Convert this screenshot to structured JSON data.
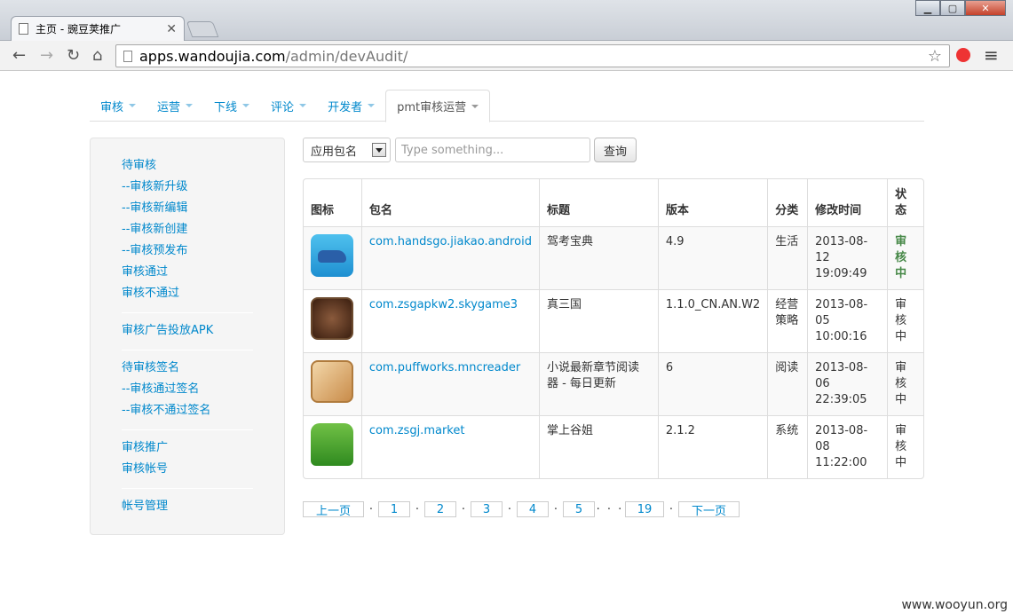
{
  "browser": {
    "tab_title": "主页 - 豌豆荚推广",
    "url_host": "apps.wandoujia.com",
    "url_path": "/admin/devAudit/"
  },
  "topnav": [
    {
      "label": "审核"
    },
    {
      "label": "运营"
    },
    {
      "label": "下线"
    },
    {
      "label": "评论"
    },
    {
      "label": "开发者"
    },
    {
      "label": "pmt审核运营"
    }
  ],
  "sidebar": {
    "group1": [
      "待审核",
      "--审核新升级",
      "--审核新编辑",
      "--审核新创建",
      "--审核预发布",
      "审核通过",
      "审核不通过"
    ],
    "group2": [
      "审核广告投放APK"
    ],
    "group3": [
      "待审核签名",
      "--审核通过签名",
      "--审核不通过签名"
    ],
    "group4": [
      "审核推广",
      "审核帐号"
    ],
    "group5": [
      "帐号管理"
    ]
  },
  "filter": {
    "select_value": "应用包名",
    "search_placeholder": "Type something...",
    "query_label": "查询"
  },
  "table": {
    "headers": [
      "图标",
      "包名",
      "标题",
      "版本",
      "分类",
      "修改时间",
      "状态"
    ],
    "rows": [
      {
        "pkg": "com.handsgo.jiakao.android",
        "title": "驾考宝典",
        "version": "4.9",
        "category": "生活",
        "time": "2013-08-12 19:09:49",
        "status": "审核中"
      },
      {
        "pkg": "com.zsgapkw2.skygame3",
        "title": "真三国",
        "version": "1.1.0_CN.AN.W2",
        "category": "经营策略",
        "time": "2013-08-05 10:00:16",
        "status": "审核中"
      },
      {
        "pkg": "com.puffworks.mncreader",
        "title": "小说最新章节阅读器 - 每日更新",
        "version": "6",
        "category": "阅读",
        "time": "2013-08-06 22:39:05",
        "status": "审核中"
      },
      {
        "pkg": "com.zsgj.market",
        "title": "掌上谷姐",
        "version": "2.1.2",
        "category": "系统",
        "time": "2013-08-08 11:22:00",
        "status": "审核中"
      }
    ]
  },
  "pager": {
    "prev": "上一页",
    "pages": [
      "1",
      "2",
      "3",
      "4",
      "5"
    ],
    "ellipsis": "· · ·",
    "last": "19",
    "next": "下一页"
  },
  "watermark": "www.wooyun.org"
}
